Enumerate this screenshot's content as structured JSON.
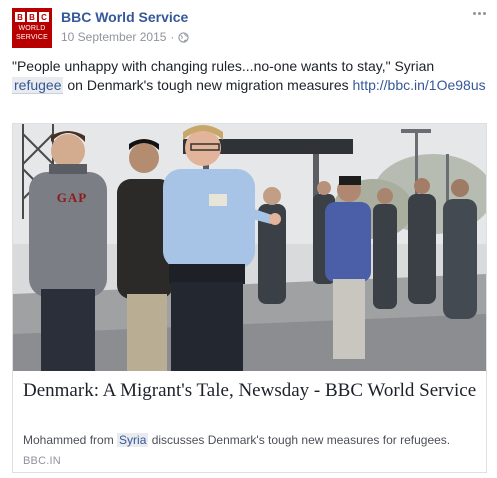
{
  "post": {
    "avatar": {
      "blocks": [
        "B",
        "B",
        "C"
      ],
      "line1": "WORLD",
      "line2": "SERVICE"
    },
    "page_name": "BBC World Service",
    "date": "10 September 2015",
    "separator": "·",
    "privacy_icon": "globe-icon",
    "menu_icon": "more-options-icon",
    "text": {
      "quote": "\"People unhappy with changing rules...no-one wants to stay,\" Syrian ",
      "hashtag": "refugee",
      "middle": " on Denmark's tough new migration measures ",
      "link": "http://bbc.in/1Oe98us"
    }
  },
  "attachment": {
    "photo_alt": "Migrants walking with a police officer",
    "shirt_text": "GAP",
    "title": "Denmark: A Migrant's Tale, Newsday - BBC World Service",
    "description_before": "Mohammed from ",
    "description_highlight": "Syria",
    "description_after": " discusses Denmark's tough new measures for refugees.",
    "domain": "BBC.IN"
  },
  "colors": {
    "link": "#365899",
    "meta": "#90949c",
    "text": "#1d2129",
    "brand": "#b80000"
  }
}
